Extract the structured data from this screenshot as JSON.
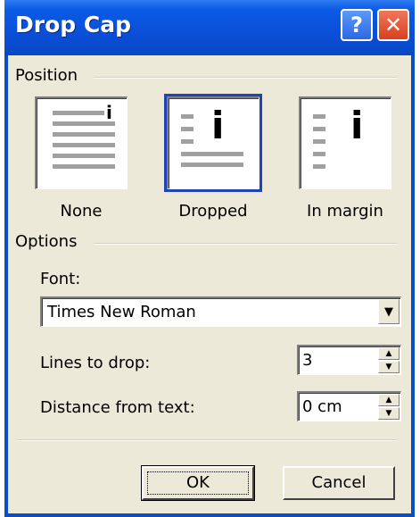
{
  "window": {
    "title": "Drop Cap",
    "help_icon": "question-mark-icon",
    "close_icon": "close-x-icon",
    "colors": {
      "titlebar": "#0a4fd8",
      "client": "#ece9d8",
      "close": "#d8401f"
    }
  },
  "position": {
    "section_label": "Position",
    "options": [
      {
        "key": "none",
        "label": "None",
        "selected": false
      },
      {
        "key": "dropped",
        "label": "Dropped",
        "selected": true
      },
      {
        "key": "in_margin",
        "label": "In margin",
        "selected": false
      }
    ],
    "cap_glyph": "i"
  },
  "options": {
    "section_label": "Options",
    "font_label": "Font:",
    "font_value": "Times New Roman",
    "lines_label": "Lines to drop:",
    "lines_value": "3",
    "distance_label": "Distance from text:",
    "distance_value": "0 cm"
  },
  "buttons": {
    "ok": "OK",
    "cancel": "Cancel"
  }
}
